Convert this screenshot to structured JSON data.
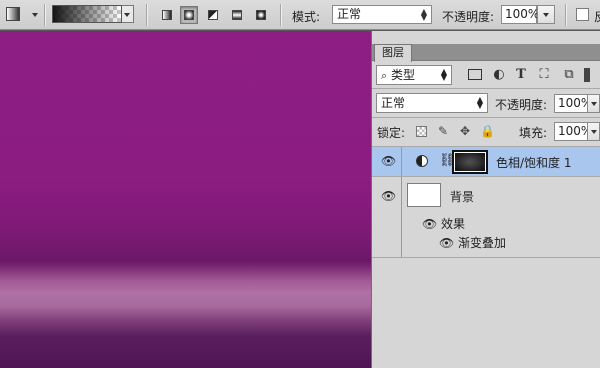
{
  "options_bar": {
    "mode_label": "模式:",
    "mode_value": "正常",
    "opacity_label": "不透明度:",
    "opacity_value": "100%",
    "gradient_types": [
      "linear",
      "radial",
      "angle",
      "reflected",
      "diamond"
    ],
    "selected_gradient_type": "radial"
  },
  "layers_panel": {
    "tab_label": "图层",
    "filter_label": "类型",
    "filter_icons": [
      "image-filter-icon",
      "adjustment-filter-icon",
      "type-filter-icon",
      "shape-filter-icon",
      "smart-object-filter-icon"
    ],
    "blend_mode": "正常",
    "opacity_label": "不透明度:",
    "opacity_value": "100%",
    "lock_label": "锁定:",
    "fill_label": "填充:",
    "fill_value": "100%",
    "layers": [
      {
        "name": "色相/饱和度 1",
        "selected": true,
        "type": "adjustment"
      },
      {
        "name": "背景",
        "selected": false,
        "type": "background"
      }
    ],
    "effects_label": "效果",
    "effect_item": "渐变叠加"
  },
  "colors": {
    "canvas_top": "#8e1e84",
    "selected_row": "#a9c6ef",
    "panel_bg": "#d6d6d6"
  }
}
